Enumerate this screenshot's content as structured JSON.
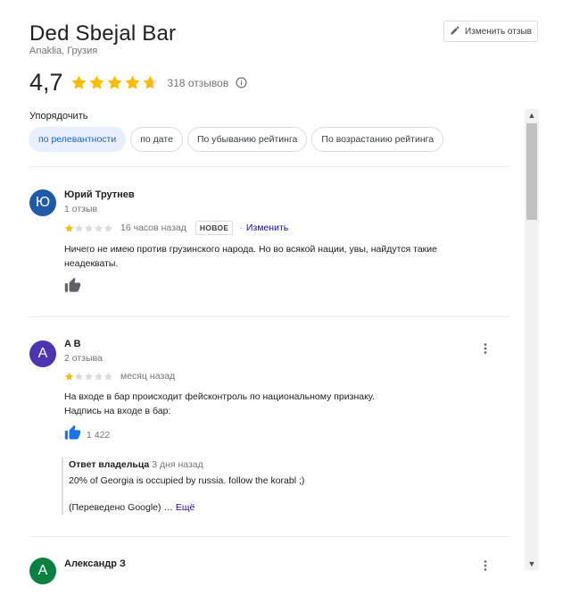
{
  "place": {
    "title": "Ded Sbejal Bar",
    "location": "Anaklia, Грузия",
    "rating": "4,7",
    "stars": 4.7,
    "reviews_count": "318 отзывов"
  },
  "edit_review_button": "Изменить отзыв",
  "sort": {
    "label": "Упорядочить",
    "options": [
      "по релевантности",
      "по дате",
      "По убыванию рейтинга",
      "По возрастанию рейтинга"
    ],
    "selected": "по релевантности"
  },
  "reviews": [
    {
      "avatar_letter": "Ю",
      "avatar_color": "#1e5aa8",
      "author": "Юрий Трутнев",
      "meta": "1 отзыв",
      "rating": 1,
      "time": "16 часов назад",
      "badge": "НОВОЕ",
      "edit_label": "Изменить",
      "text": [
        "Ничего не имею против грузинского народа. Но во всякой нации, увы, найдутся такие",
        "неадекваты."
      ]
    },
    {
      "avatar_letter": "A",
      "avatar_color": "#4d35b1",
      "author": "A B",
      "meta": "2 отзыва",
      "rating": 1,
      "time": "месяц назад",
      "text": [
        "На входе в бар происходит фейсконтроль по национальному признаку.",
        "Надпись на входе в бар:"
      ],
      "likes": "1 422",
      "owner_reply": {
        "label": "Ответ владельца",
        "time": "3 дня назад",
        "text": "20% of Georgia is occupied by russia. follow the korabl ;)",
        "translated": "(Переведено Google) … ",
        "more": "Ещё"
      }
    },
    {
      "avatar_letter": "А",
      "avatar_color": "#0b8043",
      "author": "Александр З"
    }
  ],
  "colors": {
    "star_filled": "#fbbc04",
    "star_empty": "#dadce0",
    "link": "#1a0dab",
    "chip_active_bg": "#e8f0fe",
    "chip_active_text": "#1967d2"
  },
  "icons": [
    "pencil-icon",
    "star-icon",
    "info-icon",
    "thumbs-up-icon",
    "more-vert-icon",
    "scroll-up-icon",
    "scroll-down-icon"
  ]
}
